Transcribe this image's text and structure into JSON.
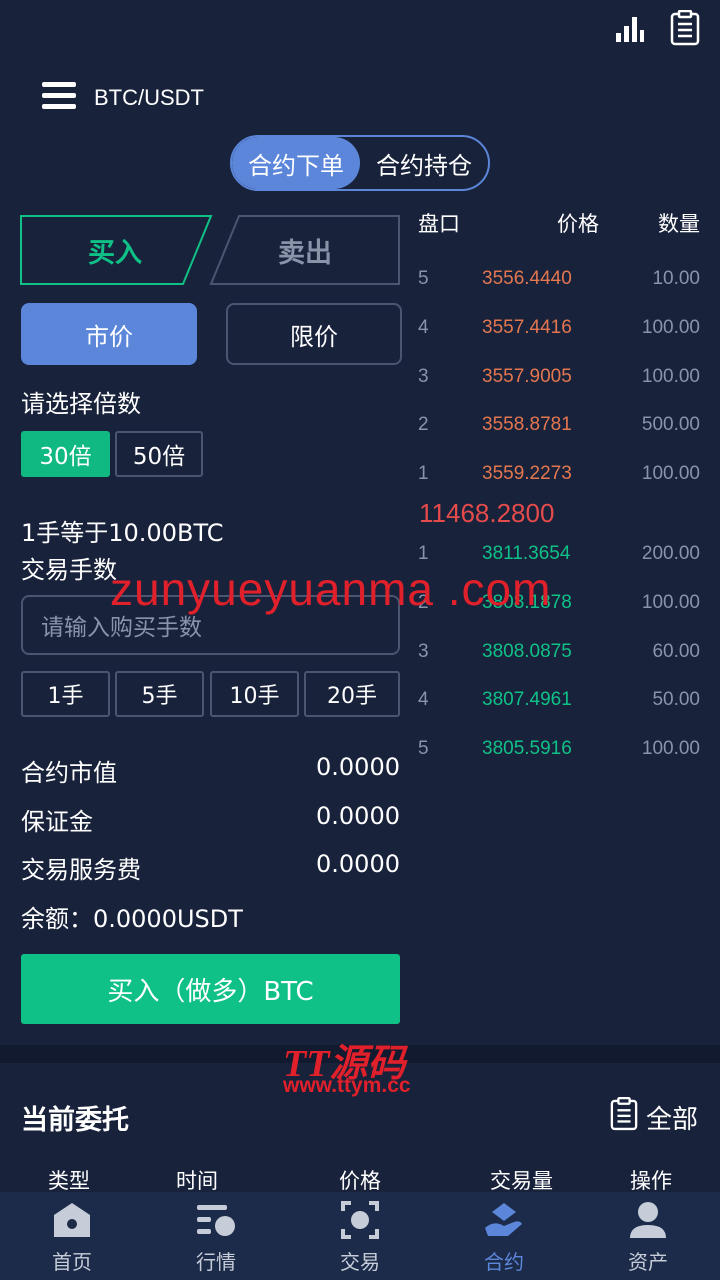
{
  "header": {
    "pair": "BTC/USDT",
    "icons": [
      "bar-chart-icon",
      "clipboard-icon",
      "menu-icon"
    ]
  },
  "segment": {
    "tabs": [
      "合约下单",
      "合约持仓"
    ],
    "active": 0
  },
  "side_tabs": {
    "buy": "买入",
    "sell": "卖出"
  },
  "order_type": {
    "market": "市价",
    "limit": "限价"
  },
  "leverage": {
    "label": "请选择倍数",
    "options": [
      "30倍",
      "50倍"
    ]
  },
  "lot_info": "1手等于10.00BTC",
  "qty": {
    "label": "交易手数",
    "placeholder": "请输入购买手数",
    "options": [
      "1手",
      "5手",
      "10手",
      "20手"
    ]
  },
  "summary": {
    "market_value_label": "合约市值",
    "market_value": "0.0000",
    "margin_label": "保证金",
    "margin": "0.0000",
    "fee_label": "交易服务费",
    "fee": "0.0000",
    "balance": "余额：0.0000USDT"
  },
  "buy_button": "买入（做多）BTC",
  "orderbook": {
    "headers": [
      "盘口",
      "价格",
      "数量"
    ],
    "asks": [
      {
        "level": "5",
        "price": "3556.4440",
        "qty": "10.00"
      },
      {
        "level": "4",
        "price": "3557.4416",
        "qty": "100.00"
      },
      {
        "level": "3",
        "price": "3557.9005",
        "qty": "100.00"
      },
      {
        "level": "2",
        "price": "3558.8781",
        "qty": "500.00"
      },
      {
        "level": "1",
        "price": "3559.2273",
        "qty": "100.00"
      }
    ],
    "mid": "11468.2800",
    "bids": [
      {
        "level": "1",
        "price": "3811.3654",
        "qty": "200.00"
      },
      {
        "level": "2",
        "price": "3808.1878",
        "qty": "100.00"
      },
      {
        "level": "3",
        "price": "3808.0875",
        "qty": "60.00"
      },
      {
        "level": "4",
        "price": "3807.4961",
        "qty": "50.00"
      },
      {
        "level": "5",
        "price": "3805.5916",
        "qty": "100.00"
      }
    ]
  },
  "watermarks": {
    "main": "zunyueyuanma .com",
    "logo": "TT源码",
    "url": "www.ttym.cc"
  },
  "orders": {
    "title": "当前委托",
    "all": "全部",
    "columns": [
      "类型",
      "时间",
      "价格",
      "交易量",
      "操作"
    ]
  },
  "nav": [
    {
      "label": "首页",
      "icon": "home-icon"
    },
    {
      "label": "行情",
      "icon": "market-icon"
    },
    {
      "label": "交易",
      "icon": "trade-icon"
    },
    {
      "label": "合约",
      "icon": "contract-icon"
    },
    {
      "label": "资产",
      "icon": "user-icon"
    }
  ],
  "colors": {
    "accent": "#5b86d9",
    "green": "#10c187",
    "ask": "#e4774f",
    "background": "#18223b"
  }
}
